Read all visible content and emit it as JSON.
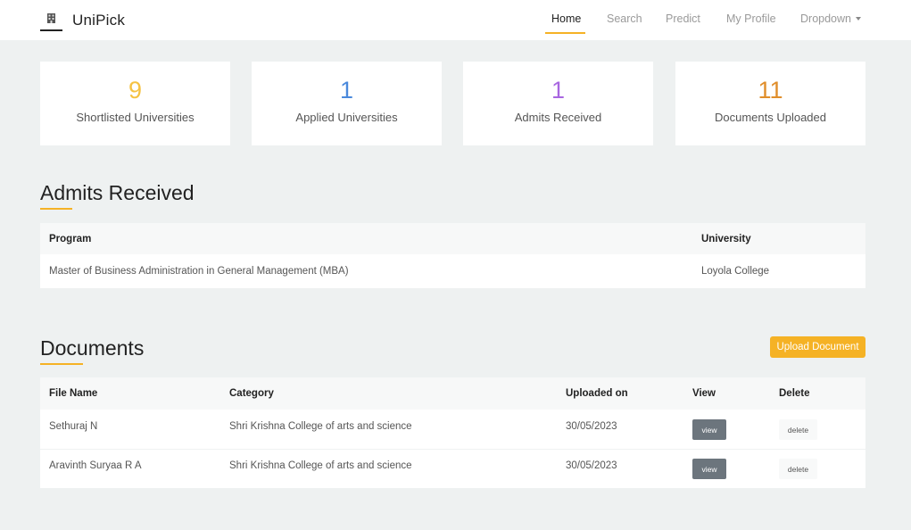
{
  "navbar": {
    "brand": "UniPick",
    "items": [
      "Home",
      "Search",
      "Predict",
      "My Profile",
      "Dropdown"
    ],
    "active": "Home",
    "accent": "#f5b225"
  },
  "stats": [
    {
      "value": "9",
      "label": "Shortlisted Universities",
      "color": "#f5c242"
    },
    {
      "value": "1",
      "label": "Applied Universities",
      "color": "#4a89dc"
    },
    {
      "value": "1",
      "label": "Admits Received",
      "color": "#a866e0"
    },
    {
      "value": "11",
      "label": "Documents Uploaded",
      "color": "#e08e2b"
    }
  ],
  "admits": {
    "title": "Admits Received",
    "headers": {
      "program": "Program",
      "university": "University"
    },
    "rows": [
      {
        "program": "Master of Business Administration in General Management (MBA)",
        "university": "Loyola College"
      }
    ]
  },
  "documents": {
    "title": "Documents",
    "upload_label": "Upload Document",
    "headers": {
      "file_name": "File Name",
      "category": "Category",
      "uploaded_on": "Uploaded on",
      "view": "View",
      "delete": "Delete"
    },
    "rows": [
      {
        "file_name": "Sethuraj N",
        "category": "Shri Krishna College of arts and science",
        "uploaded_on": "30/05/2023",
        "view_label": "view",
        "delete_label": "delete"
      },
      {
        "file_name": "Aravinth Suryaa R A",
        "category": "Shri Krishna College of arts and science",
        "uploaded_on": "30/05/2023",
        "view_label": "view",
        "delete_label": "delete"
      }
    ]
  }
}
